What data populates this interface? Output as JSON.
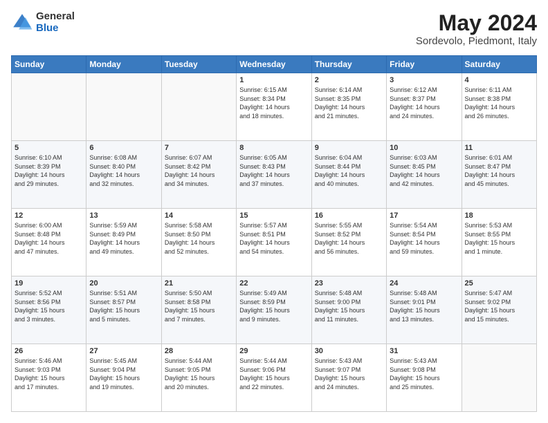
{
  "logo": {
    "general": "General",
    "blue": "Blue"
  },
  "title": "May 2024",
  "location": "Sordevolo, Piedmont, Italy",
  "weekdays": [
    "Sunday",
    "Monday",
    "Tuesday",
    "Wednesday",
    "Thursday",
    "Friday",
    "Saturday"
  ],
  "weeks": [
    [
      {
        "day": "",
        "info": ""
      },
      {
        "day": "",
        "info": ""
      },
      {
        "day": "",
        "info": ""
      },
      {
        "day": "1",
        "info": "Sunrise: 6:15 AM\nSunset: 8:34 PM\nDaylight: 14 hours\nand 18 minutes."
      },
      {
        "day": "2",
        "info": "Sunrise: 6:14 AM\nSunset: 8:35 PM\nDaylight: 14 hours\nand 21 minutes."
      },
      {
        "day": "3",
        "info": "Sunrise: 6:12 AM\nSunset: 8:37 PM\nDaylight: 14 hours\nand 24 minutes."
      },
      {
        "day": "4",
        "info": "Sunrise: 6:11 AM\nSunset: 8:38 PM\nDaylight: 14 hours\nand 26 minutes."
      }
    ],
    [
      {
        "day": "5",
        "info": "Sunrise: 6:10 AM\nSunset: 8:39 PM\nDaylight: 14 hours\nand 29 minutes."
      },
      {
        "day": "6",
        "info": "Sunrise: 6:08 AM\nSunset: 8:40 PM\nDaylight: 14 hours\nand 32 minutes."
      },
      {
        "day": "7",
        "info": "Sunrise: 6:07 AM\nSunset: 8:42 PM\nDaylight: 14 hours\nand 34 minutes."
      },
      {
        "day": "8",
        "info": "Sunrise: 6:05 AM\nSunset: 8:43 PM\nDaylight: 14 hours\nand 37 minutes."
      },
      {
        "day": "9",
        "info": "Sunrise: 6:04 AM\nSunset: 8:44 PM\nDaylight: 14 hours\nand 40 minutes."
      },
      {
        "day": "10",
        "info": "Sunrise: 6:03 AM\nSunset: 8:45 PM\nDaylight: 14 hours\nand 42 minutes."
      },
      {
        "day": "11",
        "info": "Sunrise: 6:01 AM\nSunset: 8:47 PM\nDaylight: 14 hours\nand 45 minutes."
      }
    ],
    [
      {
        "day": "12",
        "info": "Sunrise: 6:00 AM\nSunset: 8:48 PM\nDaylight: 14 hours\nand 47 minutes."
      },
      {
        "day": "13",
        "info": "Sunrise: 5:59 AM\nSunset: 8:49 PM\nDaylight: 14 hours\nand 49 minutes."
      },
      {
        "day": "14",
        "info": "Sunrise: 5:58 AM\nSunset: 8:50 PM\nDaylight: 14 hours\nand 52 minutes."
      },
      {
        "day": "15",
        "info": "Sunrise: 5:57 AM\nSunset: 8:51 PM\nDaylight: 14 hours\nand 54 minutes."
      },
      {
        "day": "16",
        "info": "Sunrise: 5:55 AM\nSunset: 8:52 PM\nDaylight: 14 hours\nand 56 minutes."
      },
      {
        "day": "17",
        "info": "Sunrise: 5:54 AM\nSunset: 8:54 PM\nDaylight: 14 hours\nand 59 minutes."
      },
      {
        "day": "18",
        "info": "Sunrise: 5:53 AM\nSunset: 8:55 PM\nDaylight: 15 hours\nand 1 minute."
      }
    ],
    [
      {
        "day": "19",
        "info": "Sunrise: 5:52 AM\nSunset: 8:56 PM\nDaylight: 15 hours\nand 3 minutes."
      },
      {
        "day": "20",
        "info": "Sunrise: 5:51 AM\nSunset: 8:57 PM\nDaylight: 15 hours\nand 5 minutes."
      },
      {
        "day": "21",
        "info": "Sunrise: 5:50 AM\nSunset: 8:58 PM\nDaylight: 15 hours\nand 7 minutes."
      },
      {
        "day": "22",
        "info": "Sunrise: 5:49 AM\nSunset: 8:59 PM\nDaylight: 15 hours\nand 9 minutes."
      },
      {
        "day": "23",
        "info": "Sunrise: 5:48 AM\nSunset: 9:00 PM\nDaylight: 15 hours\nand 11 minutes."
      },
      {
        "day": "24",
        "info": "Sunrise: 5:48 AM\nSunset: 9:01 PM\nDaylight: 15 hours\nand 13 minutes."
      },
      {
        "day": "25",
        "info": "Sunrise: 5:47 AM\nSunset: 9:02 PM\nDaylight: 15 hours\nand 15 minutes."
      }
    ],
    [
      {
        "day": "26",
        "info": "Sunrise: 5:46 AM\nSunset: 9:03 PM\nDaylight: 15 hours\nand 17 minutes."
      },
      {
        "day": "27",
        "info": "Sunrise: 5:45 AM\nSunset: 9:04 PM\nDaylight: 15 hours\nand 19 minutes."
      },
      {
        "day": "28",
        "info": "Sunrise: 5:44 AM\nSunset: 9:05 PM\nDaylight: 15 hours\nand 20 minutes."
      },
      {
        "day": "29",
        "info": "Sunrise: 5:44 AM\nSunset: 9:06 PM\nDaylight: 15 hours\nand 22 minutes."
      },
      {
        "day": "30",
        "info": "Sunrise: 5:43 AM\nSunset: 9:07 PM\nDaylight: 15 hours\nand 24 minutes."
      },
      {
        "day": "31",
        "info": "Sunrise: 5:43 AM\nSunset: 9:08 PM\nDaylight: 15 hours\nand 25 minutes."
      },
      {
        "day": "",
        "info": ""
      }
    ]
  ]
}
